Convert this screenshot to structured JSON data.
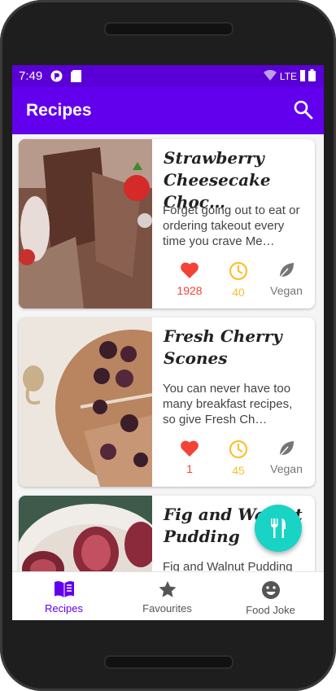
{
  "status_bar": {
    "time": "7:49",
    "network": "LTE"
  },
  "app_bar": {
    "title": "Recipes",
    "search_icon": "search-icon"
  },
  "recipes": [
    {
      "title": "Strawberry\nCheesecake Choc…",
      "description": "Forget going out to eat or ordering takeout every time you crave Me…",
      "likes": "1928",
      "minutes": "40",
      "vegan_label": "Vegan",
      "vegan": false
    },
    {
      "title": "Fresh Cherry\nScones",
      "description": "You can never have too many breakfast recipes, so give Fresh Ch…",
      "likes": "1",
      "minutes": "45",
      "vegan_label": "Vegan",
      "vegan": false
    },
    {
      "title": "Fig and Walnut\nPudding",
      "description": "Fig and Walnut Pudding"
    }
  ],
  "fab": {
    "icon": "utensils-icon"
  },
  "bottom_nav": [
    {
      "label": "Recipes",
      "icon": "menu-book-icon",
      "active": true
    },
    {
      "label": "Favourites",
      "icon": "star-icon",
      "active": false
    },
    {
      "label": "Food Joke",
      "icon": "smiley-icon",
      "active": false
    }
  ],
  "colors": {
    "primary": "#6200ee",
    "status_bar": "#5a00d6",
    "like_red": "#f44336",
    "time_amber": "#fbc02d",
    "vegan_gray": "#757575",
    "fab_teal": "#19d3c5"
  }
}
